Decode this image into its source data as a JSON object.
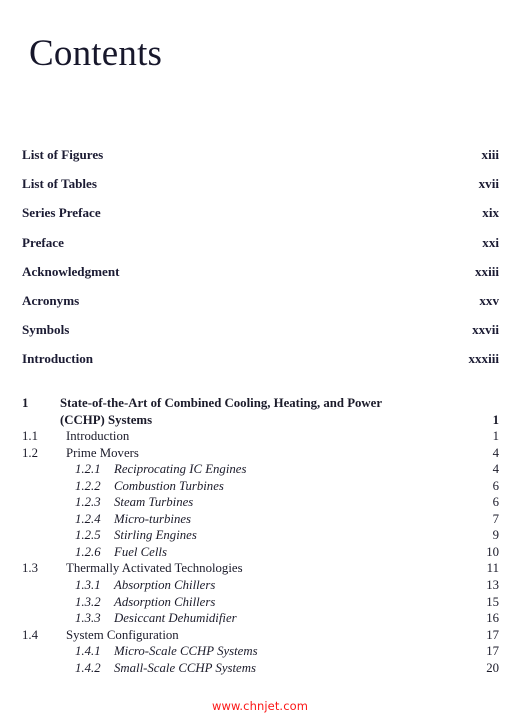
{
  "page": {
    "title": "Contents",
    "watermark": "www.chnjet.com",
    "text_color": "#1b1b33",
    "watermark_color": "#fb1616",
    "background_color": "#ffffff"
  },
  "front_matter": [
    {
      "label": "List of Figures",
      "page": "xiii"
    },
    {
      "label": "List of Tables",
      "page": "xvii"
    },
    {
      "label": "Series Preface",
      "page": "xix"
    },
    {
      "label": "Preface",
      "page": "xxi"
    },
    {
      "label": "Acknowledgment",
      "page": "xxiii"
    },
    {
      "label": "Acronyms",
      "page": "xxv"
    },
    {
      "label": "Symbols",
      "page": "xxvii"
    },
    {
      "label": "Introduction",
      "page": "xxxiii"
    }
  ],
  "body_matter": [
    {
      "level": "chapter",
      "number": "1",
      "title_line1": "State-of-the-Art of Combined Cooling, Heating, and Power",
      "title_line2": "(CCHP) Systems",
      "page": "1"
    },
    {
      "level": "section",
      "number": "1.1",
      "title": "Introduction",
      "page": "1"
    },
    {
      "level": "section",
      "number": "1.2",
      "title": "Prime Movers",
      "page": "4"
    },
    {
      "level": "subsection",
      "number": "1.2.1",
      "title": "Reciprocating IC Engines",
      "page": "4"
    },
    {
      "level": "subsection",
      "number": "1.2.2",
      "title": "Combustion Turbines",
      "page": "6"
    },
    {
      "level": "subsection",
      "number": "1.2.3",
      "title": "Steam Turbines",
      "page": "6"
    },
    {
      "level": "subsection",
      "number": "1.2.4",
      "title": "Micro-turbines",
      "page": "7"
    },
    {
      "level": "subsection",
      "number": "1.2.5",
      "title": "Stirling Engines",
      "page": "9"
    },
    {
      "level": "subsection",
      "number": "1.2.6",
      "title": "Fuel Cells",
      "page": "10"
    },
    {
      "level": "section",
      "number": "1.3",
      "title": "Thermally Activated Technologies",
      "page": "11"
    },
    {
      "level": "subsection",
      "number": "1.3.1",
      "title": "Absorption Chillers",
      "page": "13"
    },
    {
      "level": "subsection",
      "number": "1.3.2",
      "title": "Adsorption Chillers",
      "page": "15"
    },
    {
      "level": "subsection",
      "number": "1.3.3",
      "title": "Desiccant Dehumidifier",
      "page": "16"
    },
    {
      "level": "section",
      "number": "1.4",
      "title": "System Configuration",
      "page": "17"
    },
    {
      "level": "subsection",
      "number": "1.4.1",
      "title": "Micro-Scale CCHP Systems",
      "page": "17"
    },
    {
      "level": "subsection",
      "number": "1.4.2",
      "title": "Small-Scale CCHP Systems",
      "page": "20"
    }
  ]
}
